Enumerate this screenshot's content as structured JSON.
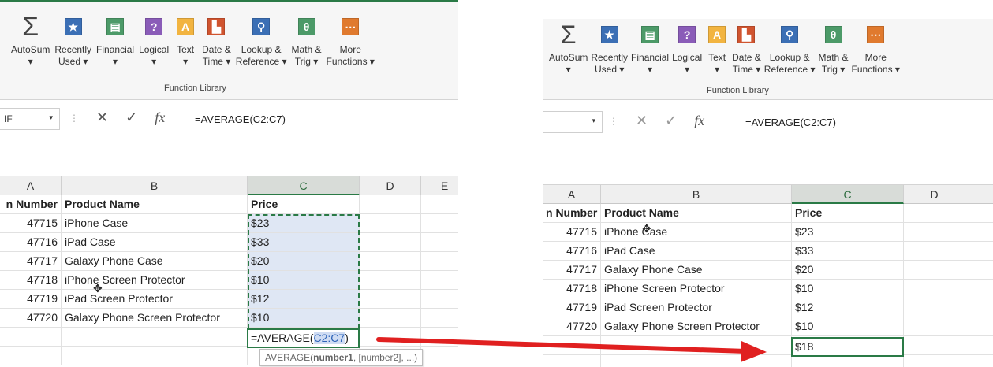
{
  "ribbon": {
    "buttons": [
      {
        "label": "AutoSum\n▾",
        "icon": "sigma-icon"
      },
      {
        "label": "Recently\nUsed ▾",
        "icon": "star-icon",
        "color": "#3b6fb5"
      },
      {
        "label": "Financial\n▾",
        "icon": "financial-icon",
        "color": "#4c9a68"
      },
      {
        "label": "Logical\n▾",
        "icon": "question-icon",
        "color": "#8a5cb8"
      },
      {
        "label": "Text\n▾",
        "icon": "text-icon",
        "color": "#f2b440"
      },
      {
        "label": "Date &\nTime ▾",
        "icon": "calendar-icon",
        "color": "#d0542f"
      },
      {
        "label": "Lookup &\nReference ▾",
        "icon": "lookup-icon",
        "color": "#3b6fb5"
      },
      {
        "label": "Math &\nTrig ▾",
        "icon": "theta-icon",
        "color": "#4c9a68"
      },
      {
        "label": "More\nFunctions ▾",
        "icon": "more-icon",
        "color": "#e07a2e"
      }
    ],
    "group_label": "Function Library"
  },
  "left": {
    "namebox": "IF",
    "formula": "=AVERAGE(C2:C7)",
    "columns": [
      "A",
      "B",
      "C",
      "D",
      "E"
    ],
    "header_row": {
      "a": "n Number",
      "b": "Product Name",
      "c": "Price"
    },
    "rows": [
      {
        "a": "47715",
        "b": "iPhone Case",
        "c": "$23"
      },
      {
        "a": "47716",
        "b": "iPad Case",
        "c": "$33"
      },
      {
        "a": "47717",
        "b": "Galaxy Phone Case",
        "c": "$20"
      },
      {
        "a": "47718",
        "b": "iPhone Screen Protector",
        "c": "$10"
      },
      {
        "a": "47719",
        "b": "iPad Screen Protector",
        "c": "$12"
      },
      {
        "a": "47720",
        "b": "Galaxy Phone Screen Protector",
        "c": "$10"
      }
    ],
    "edit_prefix": "=AVERAGE(",
    "edit_ref": "C2:C7",
    "edit_suffix": ")",
    "tooltip_fn": "AVERAGE(",
    "tooltip_arg1": "number1",
    "tooltip_rest": ", [number2], ...)"
  },
  "right": {
    "namebox": "",
    "formula": "=AVERAGE(C2:C7)",
    "columns": [
      "A",
      "B",
      "C",
      "D"
    ],
    "header_row": {
      "a": "n Number",
      "b": "Product Name",
      "c": "Price"
    },
    "rows": [
      {
        "a": "47715",
        "b": "iPhone Case",
        "c": "$23"
      },
      {
        "a": "47716",
        "b": "iPad Case",
        "c": "$33"
      },
      {
        "a": "47717",
        "b": "Galaxy Phone Case",
        "c": "$20"
      },
      {
        "a": "47718",
        "b": "iPhone Screen Protector",
        "c": "$10"
      },
      {
        "a": "47719",
        "b": "iPad Screen Protector",
        "c": "$12"
      },
      {
        "a": "47720",
        "b": "Galaxy Phone Screen Protector",
        "c": "$10"
      }
    ],
    "result": "$18"
  },
  "colors": {
    "accent": "#2a7a46",
    "arrow": "#e02020",
    "selection": "#dfe7f4"
  }
}
